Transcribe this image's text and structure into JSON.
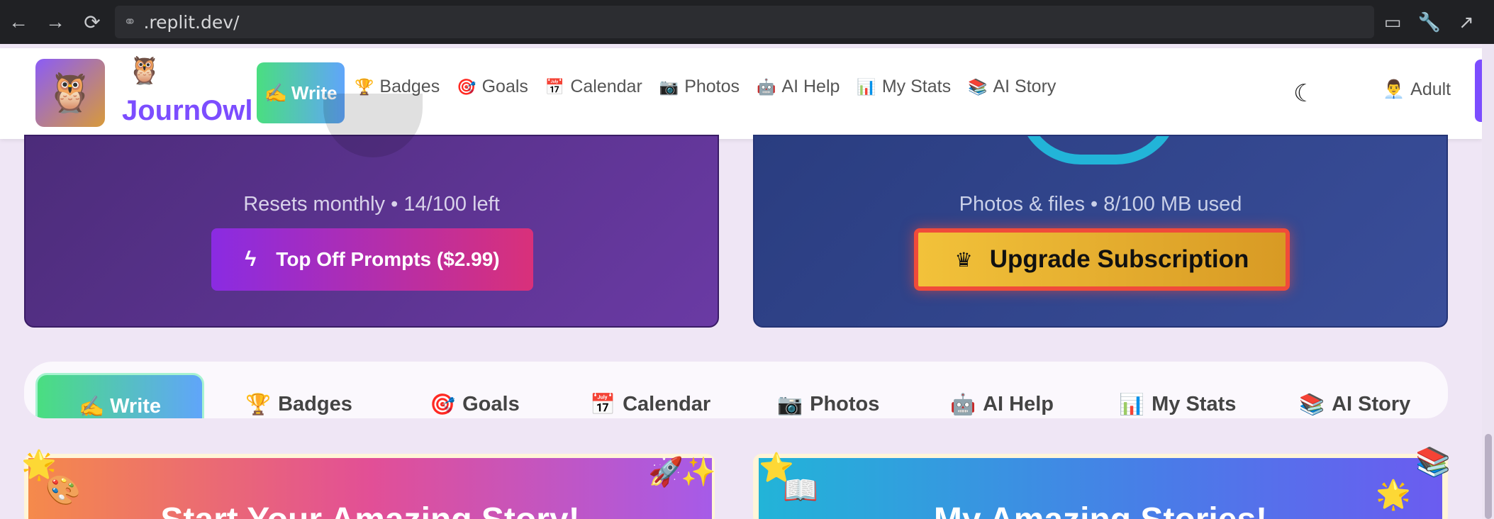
{
  "browser": {
    "url": ".replit.dev/",
    "back_icon": "arrow-left-icon",
    "forward_icon": "arrow-right-icon",
    "reload_icon": "reload-icon",
    "right_icons": [
      "devices-icon",
      "wrench-icon",
      "open-external-icon"
    ]
  },
  "header": {
    "brand": "JournOwl",
    "write_label": "Write",
    "nav": [
      {
        "icon": "🏆",
        "label": "Badges"
      },
      {
        "icon": "🎯",
        "label": "Goals"
      },
      {
        "icon": "📅",
        "label": "Calendar"
      },
      {
        "icon": "📷",
        "label": "Photos"
      },
      {
        "icon": "🤖",
        "label": "AI Help"
      },
      {
        "icon": "📊",
        "label": "My Stats"
      },
      {
        "icon": "📚",
        "label": "AI Story"
      }
    ],
    "user_label": "Adult"
  },
  "prompts_card": {
    "status": "Resets monthly • 14/100 left",
    "button": "Top Off Prompts ($2.99)"
  },
  "storage_card": {
    "status": "Photos & files • 8/100 MB used",
    "button": "Upgrade Subscription"
  },
  "tabs": {
    "write": "Write",
    "items": [
      {
        "icon": "🏆",
        "label": "Badges"
      },
      {
        "icon": "🎯",
        "label": "Goals"
      },
      {
        "icon": "📅",
        "label": "Calendar"
      },
      {
        "icon": "📷",
        "label": "Photos"
      },
      {
        "icon": "🤖",
        "label": "AI Help"
      },
      {
        "icon": "📊",
        "label": "My Stats"
      },
      {
        "icon": "📚",
        "label": "AI Story"
      }
    ]
  },
  "stories": {
    "left_title": "Start Your Amazing Story!",
    "right_title": "My Amazing Stories!"
  },
  "colors": {
    "brand": "#7c4dff",
    "upgrade_border": "#f04b3a",
    "upgrade_fill": "#f2c23a"
  }
}
